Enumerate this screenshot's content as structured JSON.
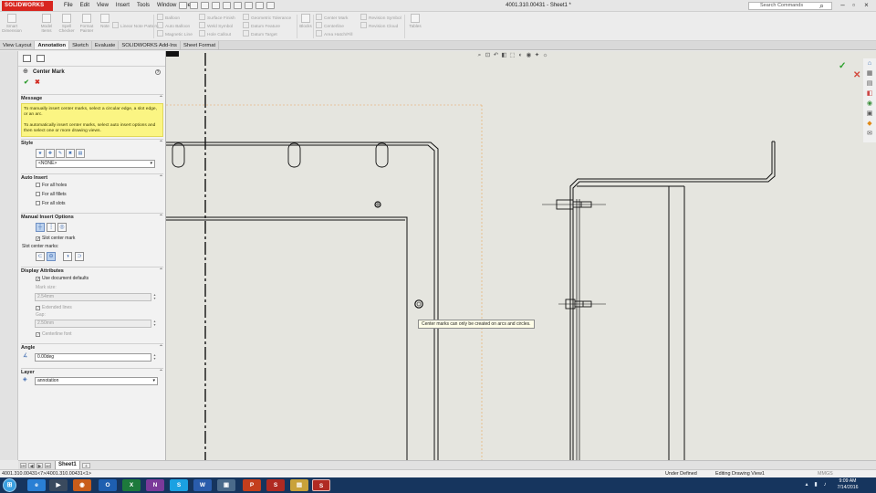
{
  "app": {
    "brand": "SOLIDWORKS",
    "document_title": "4001.310.00431 - Sheet1 *"
  },
  "menu": [
    "File",
    "Edit",
    "View",
    "Insert",
    "Tools",
    "Window",
    "Help"
  ],
  "search": {
    "placeholder": "Search Commands"
  },
  "ribbon": {
    "smart_dimension": "Smart Dimension",
    "model_items": "Model Items",
    "spell_checker": "Spell Checker",
    "format_painter": "Format Painter",
    "note": "Note",
    "linear_note_pattern": "Linear Note Pattern",
    "balloon": "Balloon",
    "auto_balloon": "Auto Balloon",
    "magnetic_line": "Magnetic Line",
    "surface_finish": "Surface Finish",
    "weld_symbol": "Weld Symbol",
    "hole_callout": "Hole Callout",
    "geometric_tolerance": "Geometric Tolerance",
    "datum_feature": "Datum Feature",
    "datum_target": "Datum Target",
    "blocks": "Blocks",
    "center_mark": "Center Mark",
    "centerline": "Centerline",
    "area_hatch_fill": "Area Hatch/Fill",
    "revision_symbol": "Revision Symbol",
    "revision_cloud": "Revision Cloud",
    "tables": "Tables"
  },
  "tabs": [
    "View Layout",
    "Annotation",
    "Sketch",
    "Evaluate",
    "SOLIDWORKS Add-Ins",
    "Sheet Format"
  ],
  "active_tab": "Annotation",
  "property_manager": {
    "title": "Center Mark",
    "ok": "✔",
    "cancel": "✖",
    "message_header": "Message",
    "message_line1": "To manually insert center marks, select a circular edge, a slot edge, or an arc.",
    "message_line2": "To automatically insert center marks, select auto insert options and then select one or more drawing views.",
    "style_header": "Style",
    "style_value": "<NONE>",
    "auto_insert_header": "Auto Insert",
    "for_all_holes": "For all holes",
    "for_all_fillets": "For all fillets",
    "for_all_slots": "For all slots",
    "manual_insert_header": "Manual Insert Options",
    "slot_center_mark": "Slot center mark",
    "slot_center_marks_label": "Slot center marks:",
    "display_attributes_header": "Display Attributes",
    "use_document_defaults": "Use document defaults",
    "mark_size_label": "Mark size:",
    "mark_size_value": "2.54mm",
    "extended_lines": "Extended lines",
    "gap_label": "Gap:",
    "gap_value": "2.50mm",
    "centerline_font": "Centerline font",
    "angle_header": "Angle",
    "angle_value": "0.00deg",
    "layer_header": "Layer",
    "layer_value": "annotation"
  },
  "canvas": {
    "tooltip": "Center marks can only be created on arcs and circles."
  },
  "sheet_tab": "Sheet1",
  "status": {
    "left": "4001.310.00431<7>/4001.310.00431<1>",
    "under_defined": "Under Defined",
    "editing": "Editing Drawing View1",
    "units": "MMGS"
  },
  "taskbar": {
    "time": "9:09 AM",
    "date": "7/14/2016"
  },
  "colors": {
    "accent": "#d8261f",
    "message_bg": "#fbf583",
    "canvas_bg": "#e5e5df",
    "taskbar": "#16355e"
  }
}
